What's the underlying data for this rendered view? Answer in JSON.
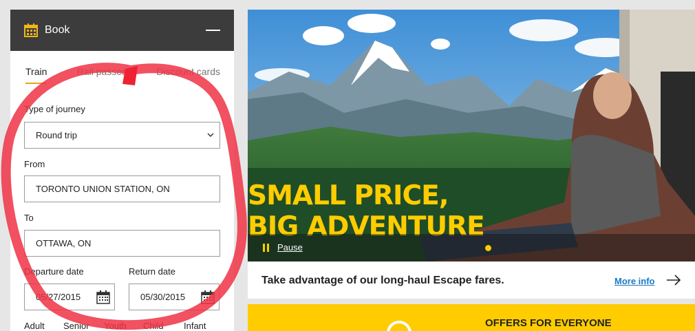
{
  "booking": {
    "title": "Book",
    "tabs": [
      {
        "label": "Train",
        "active": true
      },
      {
        "label": "Rail passes",
        "active": false
      },
      {
        "label": "Discount cards",
        "active": false
      }
    ],
    "journey_type": {
      "label": "Type of journey",
      "value": "Round trip"
    },
    "from": {
      "label": "From",
      "value": "TORONTO UNION STATION, ON"
    },
    "to": {
      "label": "To",
      "value": "OTTAWA, ON"
    },
    "departure": {
      "label": "Departure date",
      "value": "05/27/2015"
    },
    "return": {
      "label": "Return date",
      "value": "05/30/2015"
    },
    "passengers": [
      "Adult",
      "Senior",
      "Youth",
      "Child",
      "Infant"
    ]
  },
  "hero": {
    "headline_line1": "SMALL PRICE,",
    "headline_line2": "BIG ADVENTURE",
    "pause_label": "Pause"
  },
  "promo": {
    "text": "Take advantage of our long-haul Escape fares.",
    "link_label": "More info"
  },
  "offers": {
    "title": "OFFERS FOR EVERYONE"
  },
  "colors": {
    "accent": "#ffcc00",
    "header_bg": "#3c3c3c",
    "link": "#1a7ac4",
    "annotation": "#ee3344",
    "tab_underline": "#e8a317"
  }
}
